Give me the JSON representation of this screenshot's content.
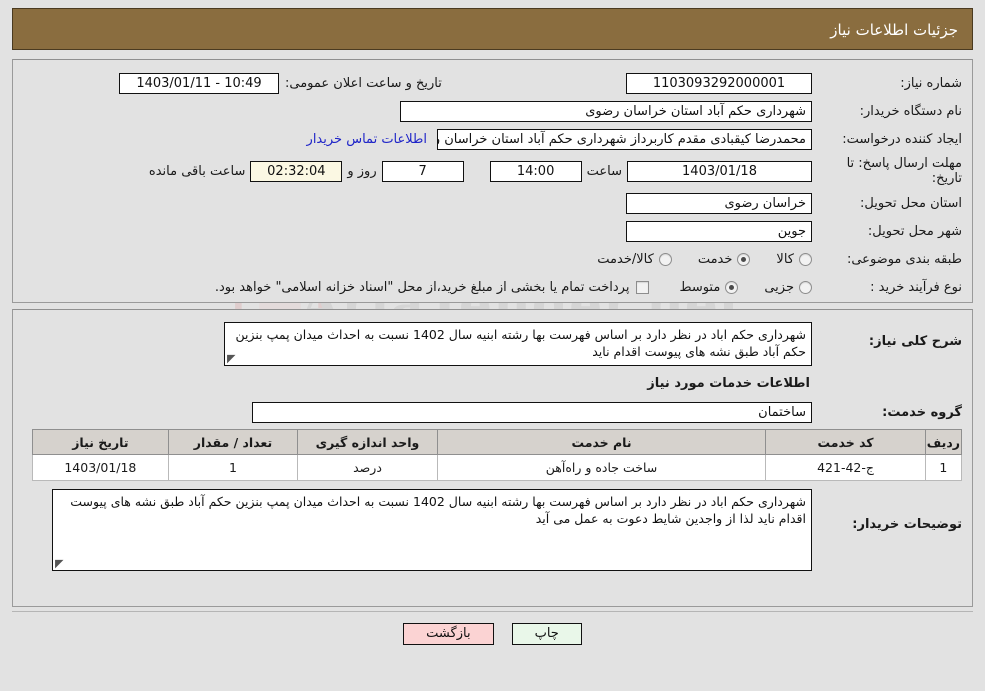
{
  "header": {
    "title": "جزئیات اطلاعات نیاز"
  },
  "info": {
    "need_number_label": "شماره نیاز:",
    "need_number_value": "1103093292000001",
    "announce_label": "تاریخ و ساعت اعلان عمومی:",
    "announce_value": "1403/01/11 - 10:49",
    "buyer_org_label": "نام دستگاه خریدار:",
    "buyer_org_value": "شهرداری حکم آباد استان خراسان رضوی",
    "creator_label": "ایجاد کننده درخواست:",
    "creator_value": "محمدرضا کیقبادی مقدم کاربرداز شهرداری حکم آباد استان خراسان رضوی",
    "contact_link": "اطلاعات تماس خریدار",
    "deadline_label": "مهلت ارسال پاسخ: تا تاریخ:",
    "deadline_date": "1403/01/18",
    "hour_label": "ساعت",
    "hour_value": "14:00",
    "days_value": "7",
    "days_text": "روز و",
    "remaining_value": "02:32:04",
    "remaining_text": "ساعت باقی مانده",
    "province_label": "استان محل تحویل:",
    "province_value": "خراسان رضوی",
    "city_label": "شهر محل تحویل:",
    "city_value": "جوین",
    "category_label": "طبقه بندی موضوعی:",
    "category_options": [
      {
        "label": "کالا",
        "selected": false
      },
      {
        "label": "خدمت",
        "selected": true
      },
      {
        "label": "کالا/خدمت",
        "selected": false
      }
    ],
    "process_label": "نوع فرآیند خرید :",
    "process_options": [
      {
        "label": "جزیی",
        "selected": false
      },
      {
        "label": "متوسط",
        "selected": true
      }
    ],
    "treasury_checked": false,
    "treasury_text": "پرداخت تمام یا بخشی از مبلغ خرید،از محل \"اسناد خزانه اسلامی\" خواهد بود."
  },
  "description": {
    "need_summary_label": "شرح کلی نیاز:",
    "need_summary_value": "شهرداری حکم اباد در نظر دارد بر اساس فهرست بها رشته ابنیه سال 1402 نسبت به احداث میدان پمپ بنزین حکم آباد طبق نشه های پیوست اقدام ناید",
    "services_heading": "اطلاعات خدمات مورد نیاز",
    "service_group_label": "گروه خدمت:",
    "service_group_value": "ساختمان",
    "buyer_notes_label": "توضیحات خریدار:",
    "buyer_notes_value": "شهرداری حکم اباد در نظر دارد بر اساس فهرست بها رشته ابنیه سال 1402 نسبت به احداث میدان پمپ بنزین حکم آباد طبق نشه های پیوست اقدام ناید لذا از واجدین شایط دعوت به عمل می آید"
  },
  "table": {
    "columns": [
      "ردیف",
      "کد خدمت",
      "نام خدمت",
      "واحد اندازه گیری",
      "تعداد / مقدار",
      "تاریخ نیاز"
    ],
    "rows": [
      {
        "radif": "1",
        "code": "ج-42-421",
        "name": "ساخت جاده و راه‌آهن",
        "unit": "درصد",
        "qty": "1",
        "date": "1403/01/18"
      }
    ]
  },
  "footer": {
    "print_label": "چاپ",
    "back_label": "بازگشت"
  },
  "watermark": {
    "text": "AriaTender.net"
  }
}
